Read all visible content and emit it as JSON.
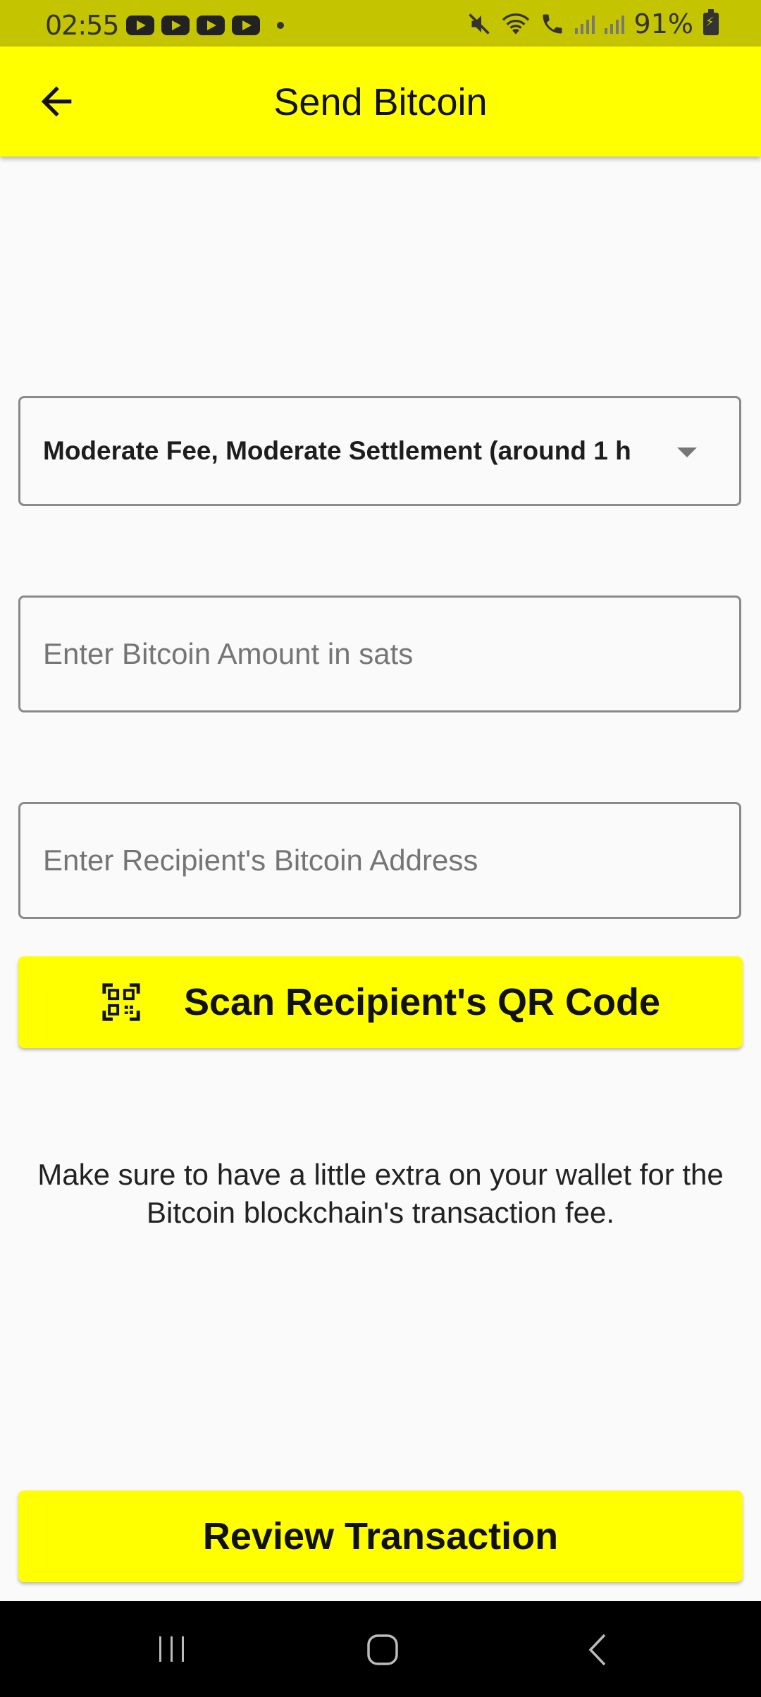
{
  "status_bar": {
    "time": "02:55",
    "notification_icons": [
      "youtube-icon",
      "youtube-icon",
      "youtube-icon",
      "youtube-icon"
    ],
    "battery_percent": "91%",
    "icons": [
      "mute-icon",
      "wifi-icon",
      "wifi-calling-icon",
      "signal-icon",
      "signal-icon",
      "battery-charging-icon"
    ]
  },
  "app_bar": {
    "title": "Send Bitcoin",
    "back_icon": "arrow-left-icon"
  },
  "form": {
    "fee_dropdown": {
      "selected": "Moderate Fee, Moderate Settlement (around 1 h",
      "icon": "caret-down-icon"
    },
    "amount_input": {
      "value": "",
      "placeholder": "Enter Bitcoin Amount in sats"
    },
    "address_input": {
      "value": "",
      "placeholder": "Enter Recipient's Bitcoin Address"
    },
    "scan_button": {
      "label": "Scan Recipient's QR Code",
      "icon": "qr-scan-icon"
    },
    "note": "Make sure to have a little extra on your wallet for the Bitcoin blockchain's transaction fee."
  },
  "review_button": {
    "label": "Review Transaction"
  },
  "nav_bar": {
    "icons": [
      "recents-icon",
      "home-icon",
      "back-icon"
    ]
  },
  "colors": {
    "accent": "#ffff00",
    "status_bar": "#c4c400",
    "background": "#fafafa",
    "nav_bar": "#000000"
  }
}
